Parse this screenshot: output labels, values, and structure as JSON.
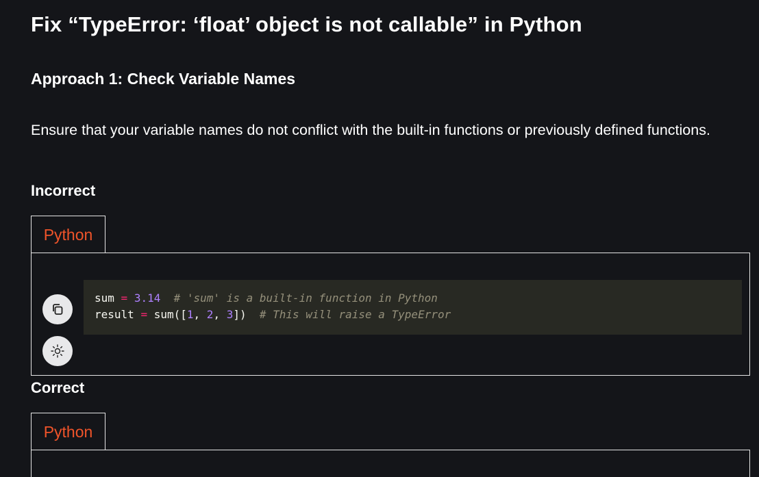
{
  "page": {
    "title": "Fix “TypeError: ‘float’ object is not callable” in Python"
  },
  "section": {
    "heading": "Approach 1: Check Variable Names",
    "paragraph": "Ensure that your variable names do not conflict with the built-in functions or previously defined functions."
  },
  "incorrect": {
    "label": "Incorrect",
    "tab_label": "Python",
    "code": {
      "line1": {
        "var": "sum",
        "op": "=",
        "num": "3.14",
        "comment": "# 'sum' is a built-in function in Python"
      },
      "line2": {
        "var": "result",
        "op": "=",
        "call_open": "sum([",
        "n1": "1",
        "n2": "2",
        "n3": "3",
        "call_close": "])",
        "comment": "# This will raise a TypeError"
      }
    },
    "icons": {
      "copy": "copy-icon",
      "theme": "sun-icon"
    }
  },
  "correct": {
    "label": "Correct",
    "tab_label": "Python"
  },
  "colors": {
    "background": "#141519",
    "accent": "#f0542a",
    "code_background": "#282923"
  }
}
